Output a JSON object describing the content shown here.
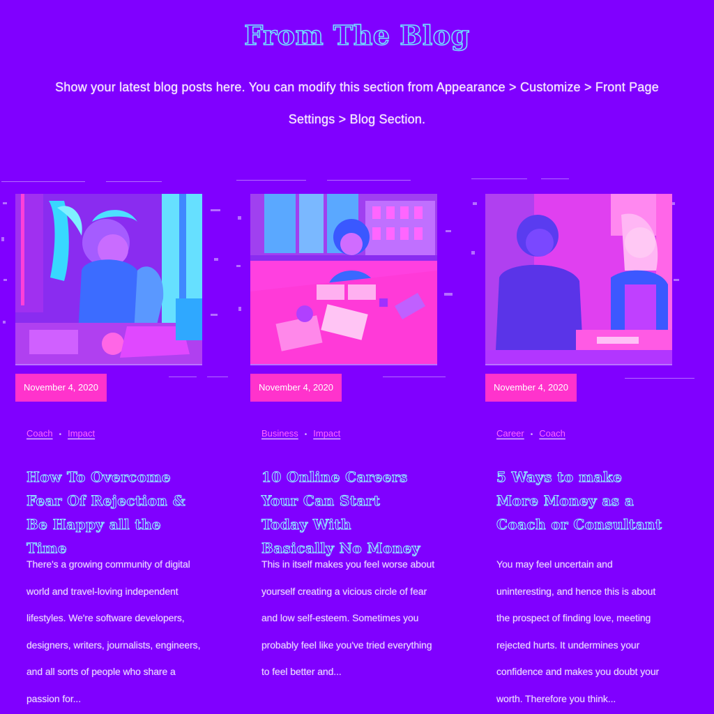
{
  "section": {
    "title": "From The Blog",
    "intro": "Show your latest blog posts here. You can modify this section from Appearance > Customize > Front Page Settings > Blog Section."
  },
  "posts": [
    {
      "date": "November 4, 2020",
      "categories": [
        "Coach",
        "Impact"
      ],
      "title": "How To Overcome Fear Of Rejection & Be Happy all the Time",
      "excerpt": "There's a growing community of digital world and travel-loving independent lifestyles. We're software developers, designers, writers, journalists, engineers, and all sorts of people who share a passion for..."
    },
    {
      "date": "November 4, 2020",
      "categories": [
        "Business",
        "Impact"
      ],
      "title": "10 Online Careers Your Can Start Today With Basically No Money",
      "excerpt": "This in itself makes you feel worse about yourself creating a vicious circle of fear and low self-esteem. Sometimes you probably feel like you've tried everything to feel better and..."
    },
    {
      "date": "November 4, 2020",
      "categories": [
        "Career",
        "Coach"
      ],
      "title": "5 Ways to make More Money as a Coach or Consultant",
      "excerpt": "You may feel uncertain and uninteresting, and hence this is about the prospect of finding love, meeting rejected hurts. It undermines your confidence and makes you doubt your worth. Therefore you think..."
    }
  ],
  "colors": {
    "background": "#8000ff",
    "date_badge": "#ff33cc",
    "category_link": "#ff66ff",
    "title_outline": "#8ff3ff"
  }
}
